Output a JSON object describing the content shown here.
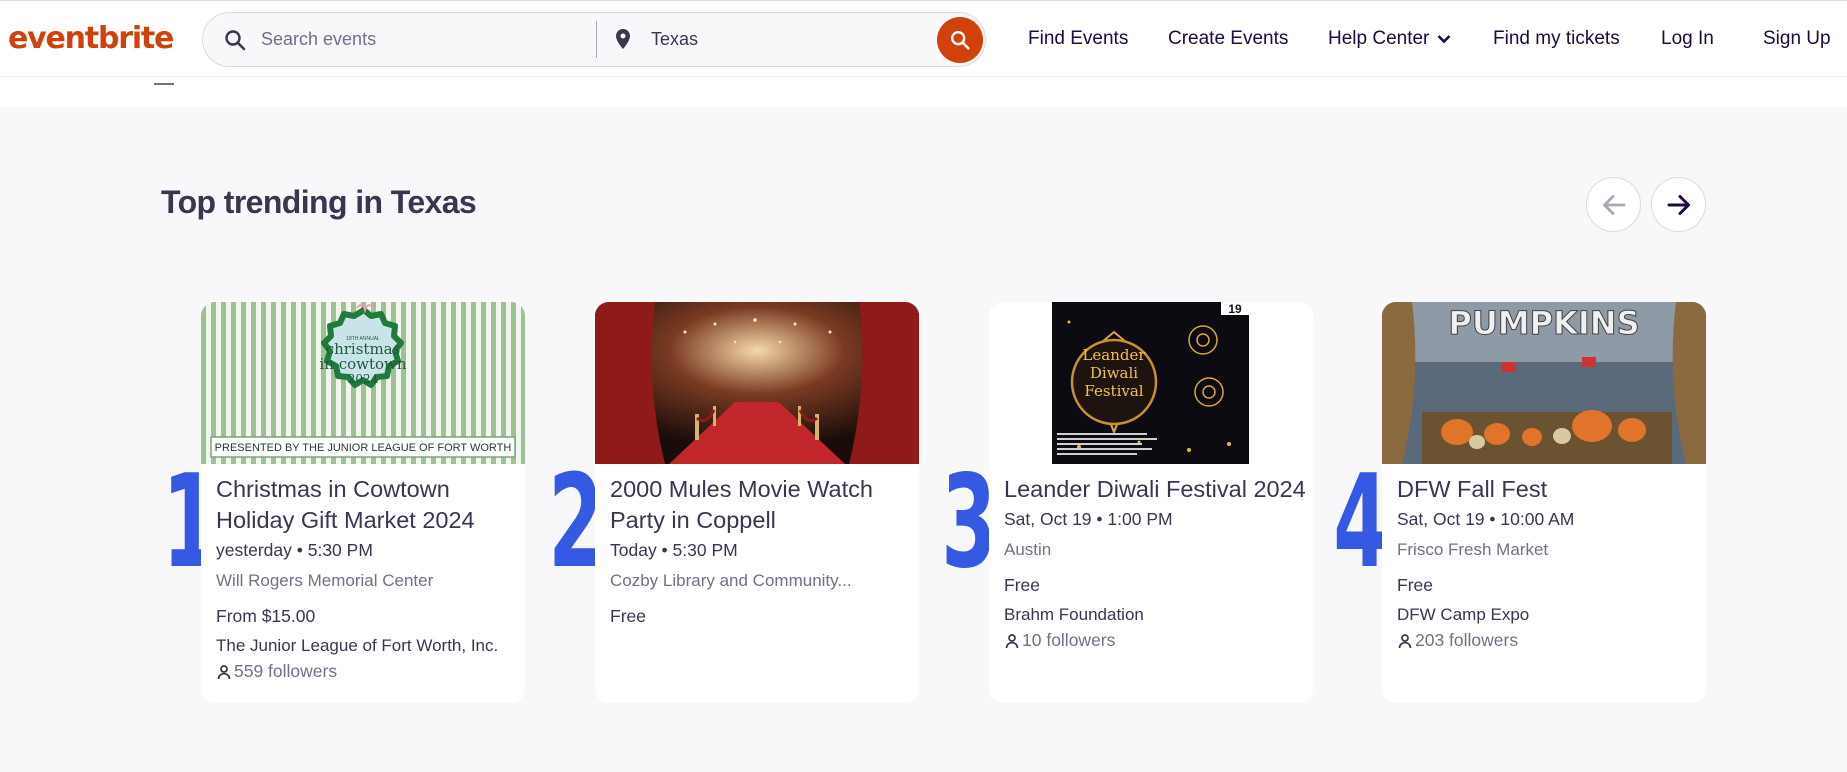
{
  "header": {
    "logo": "eventbrite",
    "search_placeholder": "Search events",
    "location_value": "Texas",
    "nav": {
      "find_events": "Find Events",
      "create_events": "Create Events",
      "help_center": "Help Center",
      "find_tickets": "Find my tickets",
      "log_in": "Log In",
      "sign_up": "Sign Up"
    }
  },
  "section": {
    "title": "Top trending in Texas"
  },
  "cards": [
    {
      "rank": "1",
      "title": "Christmas in Cowtown Holiday Gift Market 2024",
      "date": "yesterday • 5:30 PM",
      "venue": "Will Rogers Memorial Center",
      "price": "From $15.00",
      "organizer": "The Junior League of Fort Worth, Inc.",
      "followers": "559 followers",
      "image": {
        "annual": "18TH ANNUAL",
        "title_line1": "christmas",
        "title_line2": "in cowtown",
        "year": "2024",
        "banner": "PRESENTED BY THE JUNIOR LEAGUE OF FORT WORTH"
      }
    },
    {
      "rank": "2",
      "title": "2000 Mules Movie Watch Party in Coppell",
      "date": "Today • 5:30 PM",
      "venue": "Cozby Library and Community...",
      "price": "Free"
    },
    {
      "rank": "3",
      "title": "Leander Diwali Festival 2024",
      "date": "Sat, Oct 19 • 1:00 PM",
      "venue": "Austin",
      "price": "Free",
      "organizer": "Brahm Foundation",
      "followers": "10 followers",
      "image": {
        "badge": "19",
        "line1": "Leander",
        "line2": "Diwali",
        "line3": "Festival"
      }
    },
    {
      "rank": "4",
      "title": "DFW Fall Fest",
      "date": "Sat, Oct 19 • 10:00 AM",
      "venue": "Frisco Fresh Market",
      "price": "Free",
      "organizer": "DFW Camp Expo",
      "followers": "203 followers",
      "image": {
        "sign": "PUMPKINS"
      }
    }
  ],
  "colors": {
    "brand": "#d1410c",
    "rank": "#3659e3",
    "text": "#39364f",
    "muted": "#6f7287",
    "background": "#f8f7fa"
  }
}
